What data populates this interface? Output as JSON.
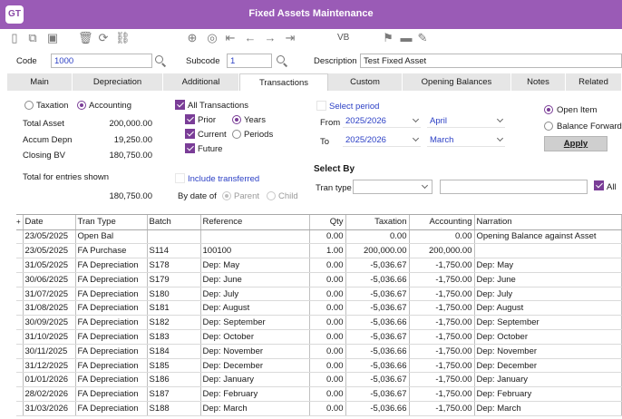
{
  "app": {
    "logo_text": "GT",
    "title": "Fixed Assets Maintenance"
  },
  "toolbar": {
    "vb_label": "VB"
  },
  "header": {
    "code_label": "Code",
    "code_value": "1000",
    "subcode_label": "Subcode",
    "subcode_value": "1",
    "description_label": "Description",
    "description_value": "Test Fixed Asset"
  },
  "tabs": [
    {
      "label": "Main"
    },
    {
      "label": "Depreciation"
    },
    {
      "label": "Additional"
    },
    {
      "label": "Transactions"
    },
    {
      "label": "Custom"
    },
    {
      "label": "Opening Balances"
    },
    {
      "label": "Notes"
    },
    {
      "label": "Related"
    }
  ],
  "active_tab": "Transactions",
  "mode": {
    "taxation_label": "Taxation",
    "accounting_label": "Accounting",
    "selected": "Accounting"
  },
  "totals": {
    "total_asset_label": "Total Asset",
    "total_asset_value": "200,000.00",
    "accum_depn_label": "Accum Depn",
    "accum_depn_value": "19,250.00",
    "closing_bv_label": "Closing BV",
    "closing_bv_value": "180,750.00",
    "entries_label": "Total for entries shown",
    "entries_value": "180,750.00"
  },
  "filters": {
    "all_transactions_label": "All Transactions",
    "prior_label": "Prior",
    "current_label": "Current",
    "future_label": "Future",
    "years_label": "Years",
    "periods_label": "Periods",
    "include_transferred_label": "Include transferred",
    "by_date_of_label": "By date of",
    "parent_label": "Parent",
    "child_label": "Child"
  },
  "period": {
    "select_period_label": "Select period",
    "from_label": "From",
    "from_year": "2025/2026",
    "from_month": "April",
    "to_label": "To",
    "to_year": "2025/2026",
    "to_month": "March"
  },
  "item_mode": {
    "open_item_label": "Open  Item",
    "balance_forward_label": "Balance Forward"
  },
  "apply_label": "Apply",
  "select_by": {
    "label": "Select By",
    "tran_type_label": "Tran type",
    "tran_type_value": "",
    "search_value": "",
    "all_label": "All"
  },
  "table": {
    "columns": [
      "Date",
      "Tran Type",
      "Batch",
      "Reference",
      "Qty",
      "Taxation",
      "Accounting",
      "Narration"
    ],
    "rows": [
      [
        "23/05/2025",
        "Open Bal",
        "",
        "",
        "0.00",
        "0.00",
        "0.00",
        "Opening Balance against Asset"
      ],
      [
        "23/05/2025",
        "FA Purchase",
        "S114",
        "100100",
        "1.00",
        "200,000.00",
        "200,000.00",
        ""
      ],
      [
        "31/05/2025",
        "FA Depreciation",
        "S178",
        "Dep: May",
        "0.00",
        "-5,036.67",
        "-1,750.00",
        "Dep: May"
      ],
      [
        "30/06/2025",
        "FA Depreciation",
        "S179",
        "Dep: June",
        "0.00",
        "-5,036.66",
        "-1,750.00",
        "Dep: June"
      ],
      [
        "31/07/2025",
        "FA Depreciation",
        "S180",
        "Dep: July",
        "0.00",
        "-5,036.67",
        "-1,750.00",
        "Dep: July"
      ],
      [
        "31/08/2025",
        "FA Depreciation",
        "S181",
        "Dep: August",
        "0.00",
        "-5,036.67",
        "-1,750.00",
        "Dep: August"
      ],
      [
        "30/09/2025",
        "FA Depreciation",
        "S182",
        "Dep: September",
        "0.00",
        "-5,036.66",
        "-1,750.00",
        "Dep: September"
      ],
      [
        "31/10/2025",
        "FA Depreciation",
        "S183",
        "Dep: October",
        "0.00",
        "-5,036.67",
        "-1,750.00",
        "Dep: October"
      ],
      [
        "30/11/2025",
        "FA Depreciation",
        "S184",
        "Dep: November",
        "0.00",
        "-5,036.66",
        "-1,750.00",
        "Dep: November"
      ],
      [
        "31/12/2025",
        "FA Depreciation",
        "S185",
        "Dep: December",
        "0.00",
        "-5,036.66",
        "-1,750.00",
        "Dep: December"
      ],
      [
        "01/01/2026",
        "FA Depreciation",
        "S186",
        "Dep: January",
        "0.00",
        "-5,036.67",
        "-1,750.00",
        "Dep: January"
      ],
      [
        "28/02/2026",
        "FA Depreciation",
        "S187",
        "Dep: February",
        "0.00",
        "-5,036.67",
        "-1,750.00",
        "Dep: February"
      ],
      [
        "31/03/2026",
        "FA Depreciation",
        "S188",
        "Dep: March",
        "0.00",
        "-5,036.66",
        "-1,750.00",
        "Dep: March"
      ]
    ]
  },
  "colors": {
    "accent": "#9a5bb6",
    "link": "#2b3fc5"
  }
}
